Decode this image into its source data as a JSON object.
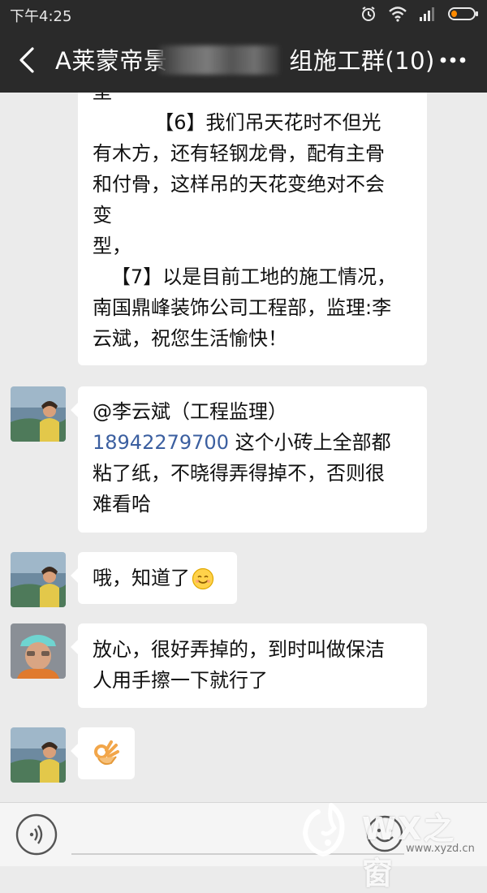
{
  "status_bar": {
    "time": "下午4:25"
  },
  "header": {
    "title": "A莱蒙帝景",
    "title_suffix": "组施工群(10)"
  },
  "messages": [
    {
      "lines": [
        "型",
        "          【6】我们吊天花时不但光",
        "有木方，还有轻钢龙骨，配有主骨",
        "和付骨，这样吊的天花变绝对不会",
        "变",
        "型，",
        "   【7】以是目前工地的施工情况，",
        "南国鼎峰装饰公司工程部，监理:李",
        "云斌，祝您生活愉快！"
      ]
    },
    {
      "line1": "@李云斌（工程监理）",
      "phone": "18942279700",
      "line2_rest": " 这个小砖上全部都",
      "line3": "粘了纸，不晓得弄得掉不，否则很",
      "line4": "难看哈"
    },
    {
      "text": "哦，知道了"
    },
    {
      "line1": "放心，很好弄掉的，到时叫做保洁",
      "line2": "人用手擦一下就行了"
    },
    {
      "emoji": "ok-hand"
    }
  ],
  "input_bar": {
    "watermark": "WX之窗",
    "watermark_url": "www.xyzd.cn"
  },
  "colors": {
    "header_bg": "#2a2a2a",
    "chat_bg": "#ebebeb",
    "link": "#3b5fa0"
  }
}
